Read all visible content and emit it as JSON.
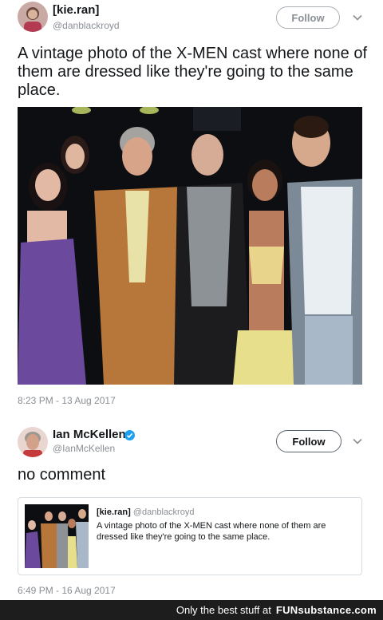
{
  "tweet1": {
    "display_name": "[kie.ran]",
    "handle": "@danblackroyd",
    "follow_label": "Follow",
    "text": "A vintage photo of the X-MEN cast where none of them are dressed like they're going to the same place.",
    "timestamp": "8:23 PM - 13 Aug 2017"
  },
  "tweet2": {
    "display_name": "Ian McKellen",
    "handle": "@IanMcKellen",
    "follow_label": "Follow",
    "text": "no comment",
    "timestamp": "6:49 PM - 16 Aug 2017",
    "quote": {
      "display_name": "[kie.ran]",
      "handle": "@danblackroyd",
      "text": "A vintage photo of the X-MEN cast where none of them are dressed like they're going to the same place."
    }
  },
  "footer": {
    "prefix": "Only the best stuff at",
    "brand": "FUNsubstance.com"
  },
  "colors": {
    "verified": "#1da1f2",
    "footer_bg": "#1d1d1d",
    "secondary_text": "#8a8f95"
  },
  "icons": [
    "avatar",
    "chevron-down-icon",
    "verified-badge-icon"
  ]
}
